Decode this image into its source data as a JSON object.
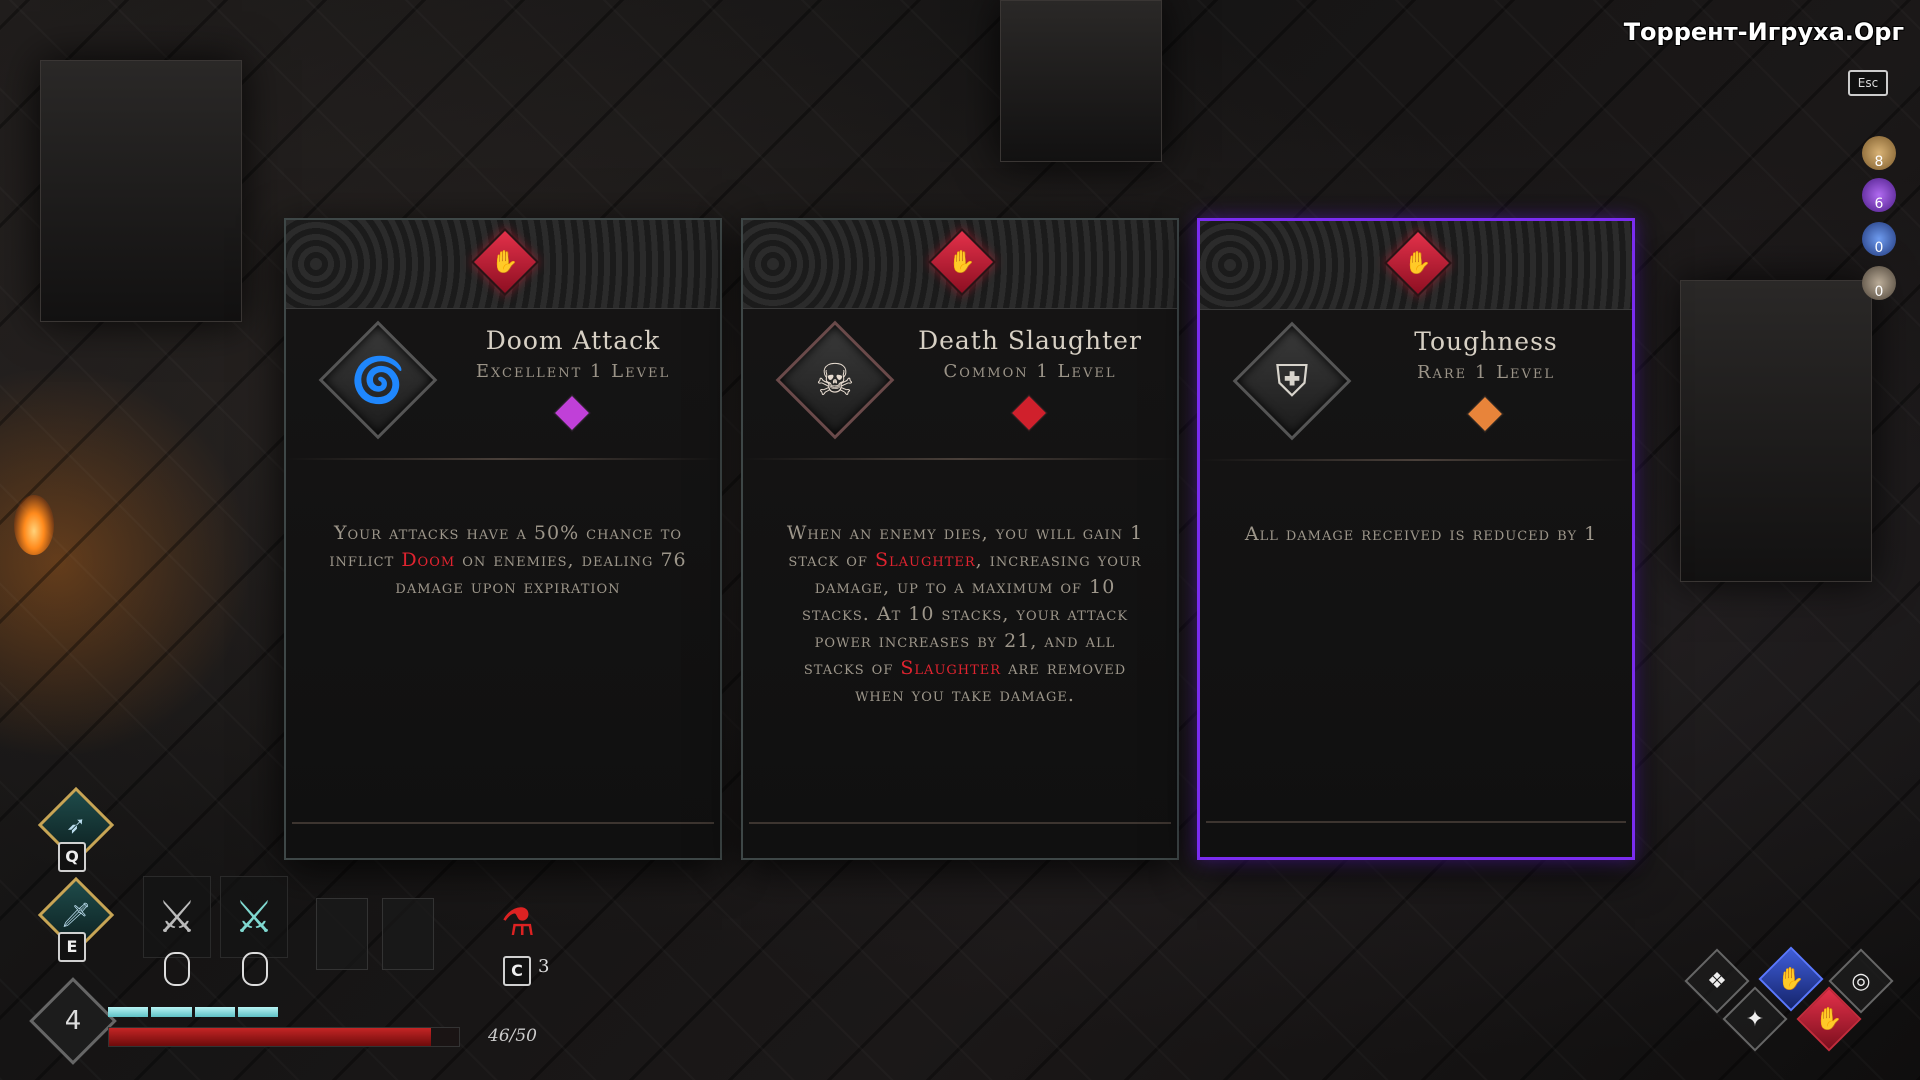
{
  "watermark": "Торрент-Игруха.Орг",
  "esc_label": "Esc",
  "currencies": [
    {
      "icon": "gold-coin-icon",
      "value": "8",
      "color": "#b8925a"
    },
    {
      "icon": "purple-soul-icon",
      "value": "6",
      "color": "#8a45d0"
    },
    {
      "icon": "blue-flame-icon",
      "value": "0",
      "color": "#3d6bc9"
    },
    {
      "icon": "skull-token-icon",
      "value": "0",
      "color": "#8c7e70"
    }
  ],
  "cards": [
    {
      "name": "Doom Attack",
      "rarity_level": "Excellent 1 Level",
      "icon": "vortex-icon",
      "gem_color": "#c040d8",
      "desc_before": "Your attacks have a 50% chance to inflict ",
      "keyword": "Doom",
      "desc_after": " on enemies, dealing 76 damage upon expiration",
      "desc_keyword2": "",
      "desc_end": ""
    },
    {
      "name": "Death Slaughter",
      "rarity_level": "Common 1 Level",
      "icon": "skull-icon",
      "gem_color": "#d0202c",
      "desc_before": "When an enemy dies, you will gain 1 stack of ",
      "keyword": "Slaughter",
      "desc_after": ", increasing your damage, up to a maximum of 10 stacks. At 10 stacks, your attack power increases by 21, and all stacks of ",
      "desc_keyword2": "Slaughter",
      "desc_end": " are removed when you take damage."
    },
    {
      "name": "Toughness",
      "rarity_level": "Rare 1 Level",
      "icon": "armor-icon",
      "gem_color": "#e8843a",
      "desc_before": "All damage received is reduced by 1",
      "keyword": "",
      "desc_after": "",
      "desc_keyword2": "",
      "desc_end": ""
    }
  ],
  "hud": {
    "skill_q_key": "Q",
    "skill_e_key": "E",
    "potion_key": "C",
    "potion_count": "3",
    "level": "4",
    "hp_text": "46/50",
    "hp_fraction": 0.92,
    "mana_segments": 4
  }
}
